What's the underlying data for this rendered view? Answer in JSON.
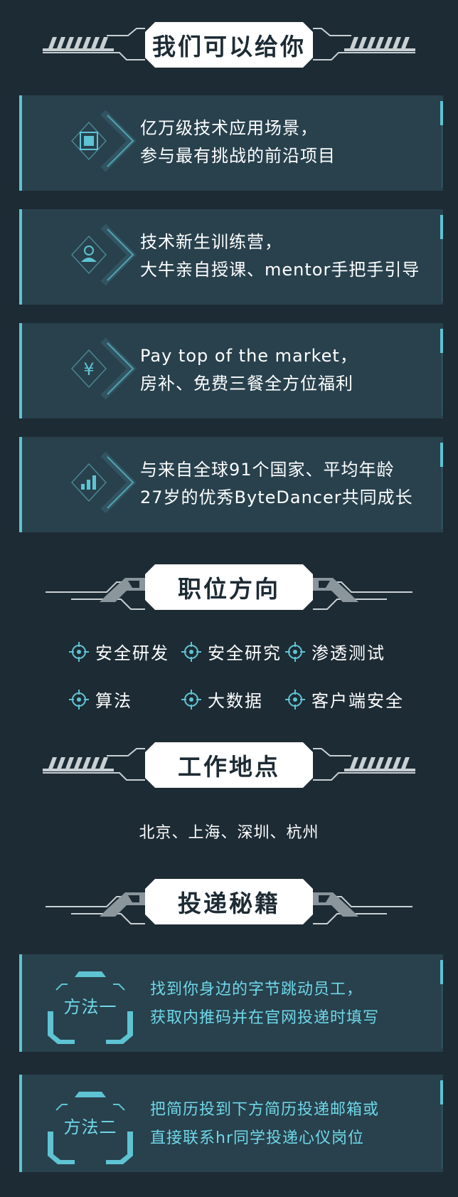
{
  "sections": {
    "offer": "我们可以给你",
    "positions": "职位方向",
    "locations": "工作地点",
    "tips": "投递秘籍"
  },
  "benefits": [
    {
      "icon": "cube-icon",
      "line1": "亿万级技术应用场景，",
      "line2": "参与最有挑战的前沿项目"
    },
    {
      "icon": "person-icon",
      "line1": "技术新生训练营，",
      "line2": "大牛亲自授课、mentor手把手引导"
    },
    {
      "icon": "yen-icon",
      "line1": "Pay top of the market，",
      "line2": "房补、免费三餐全方位福利"
    },
    {
      "icon": "bar-chart-icon",
      "line1": "与来自全球91个国家、平均年龄",
      "line2": "27岁的优秀ByteDancer共同成长"
    }
  ],
  "positions": [
    "安全研发",
    "安全研究",
    "渗透测试",
    "算法",
    "大数据",
    "客户端安全"
  ],
  "locations_text": "北京、上海、深圳、杭州",
  "methods": [
    {
      "label": "方法一",
      "line1": "找到你身边的字节跳动员工，",
      "line2": "获取内推码并在官网投递时填写"
    },
    {
      "label": "方法二",
      "line1": "把简历投到下方简历投递邮箱或",
      "line2": "直接联系hr同学投递心仪岗位"
    }
  ],
  "colors": {
    "background": "#1d2b34",
    "card": "#28414d",
    "accent": "#5ec3d3",
    "method_text": "#6fd7e8"
  }
}
